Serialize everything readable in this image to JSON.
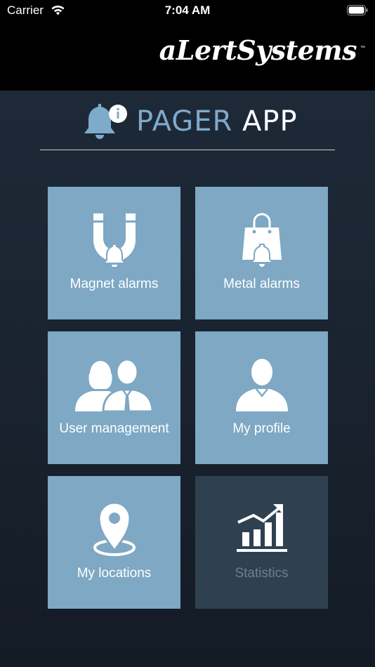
{
  "status_bar": {
    "carrier": "Carrier",
    "time": "7:04 AM"
  },
  "brand": {
    "logo_text": "aLertSystems",
    "trademark": "™"
  },
  "header": {
    "title_part1": "PAGER",
    "title_part2": "APP"
  },
  "tiles": [
    {
      "label": "Magnet alarms",
      "icon": "magnet-bell-icon",
      "enabled": true
    },
    {
      "label": "Metal alarms",
      "icon": "bag-bell-icon",
      "enabled": true
    },
    {
      "label": "User management",
      "icon": "users-icon",
      "enabled": true
    },
    {
      "label": "My profile",
      "icon": "person-icon",
      "enabled": true
    },
    {
      "label": "My locations",
      "icon": "location-pin-icon",
      "enabled": true
    },
    {
      "label": "Statistics",
      "icon": "bar-chart-icon",
      "enabled": false
    }
  ],
  "colors": {
    "tile": "#7ea8c3",
    "tile_disabled": "#2f4150",
    "title_accent": "#7eaacb",
    "background": "#1b2532"
  }
}
